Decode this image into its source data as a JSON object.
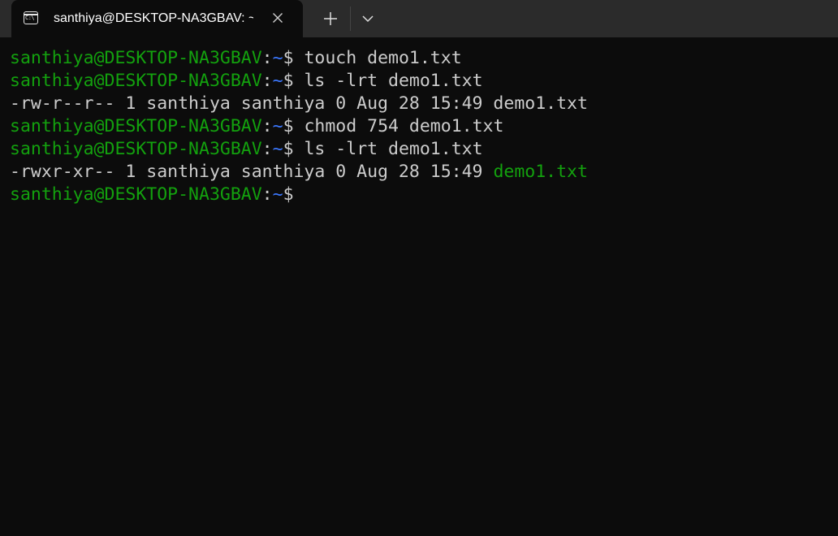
{
  "tab": {
    "title": "santhiya@DESKTOP-NA3GBAV: ~",
    "icon": "terminal-icon",
    "icon_glyph": "C:\\"
  },
  "controls": {
    "close_icon": "close-icon",
    "new_tab_icon": "plus-icon",
    "dropdown_icon": "chevron-down-icon"
  },
  "terminal": {
    "user_host": "santhiya@DESKTOP-NA3GBAV",
    "colon": ":",
    "path": "~",
    "dollar": "$",
    "lines": [
      {
        "type": "prompt",
        "command": " touch demo1.txt"
      },
      {
        "type": "prompt",
        "command": " ls -lrt demo1.txt"
      },
      {
        "type": "output",
        "text": "-rw-r--r-- 1 santhiya santhiya 0 Aug 28 15:49 demo1.txt"
      },
      {
        "type": "prompt",
        "command": " chmod 754 demo1.txt"
      },
      {
        "type": "prompt",
        "command": " ls -lrt demo1.txt"
      },
      {
        "type": "output",
        "text": "-rwxr-xr-- 1 santhiya santhiya 0 Aug 28 15:49 ",
        "highlight": "demo1.txt"
      },
      {
        "type": "prompt",
        "command": ""
      }
    ]
  },
  "colors": {
    "background": "#0c0c0c",
    "titlebar": "#2b2b2b",
    "prompt_user": "#13a10e",
    "prompt_path": "#3b78ff",
    "text": "#cccccc",
    "executable_file": "#13a10e"
  }
}
